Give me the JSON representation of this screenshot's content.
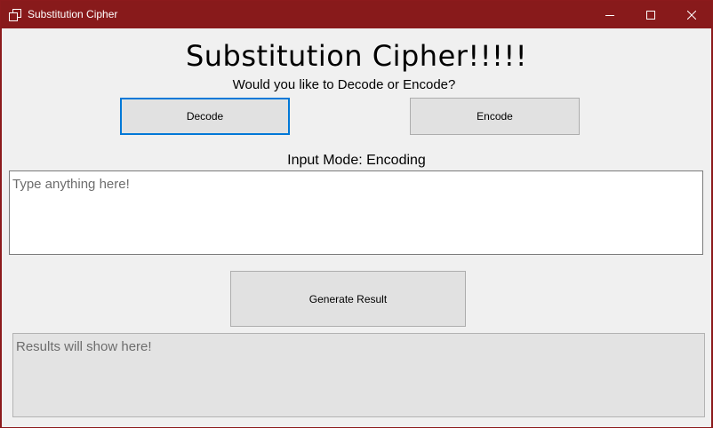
{
  "window": {
    "title": "Substitution Cipher",
    "titlebar_color": "#881a1b",
    "icons": [
      "app-icon",
      "minimize-icon",
      "maximize-icon",
      "close-icon"
    ]
  },
  "main": {
    "heading": "Substitution Cipher!!!!!",
    "prompt": "Would you like to Decode or Encode?",
    "decode_label": "Decode",
    "encode_label": "Encode",
    "mode_label": "Input Mode: Encoding",
    "input_placeholder": "Type anything here!",
    "generate_label": "Generate Result",
    "result_placeholder": "Results will show here!"
  },
  "colors": {
    "focus_border": "#0078d7",
    "button_bg": "#e1e1e1",
    "client_bg": "#f0f0f0"
  }
}
